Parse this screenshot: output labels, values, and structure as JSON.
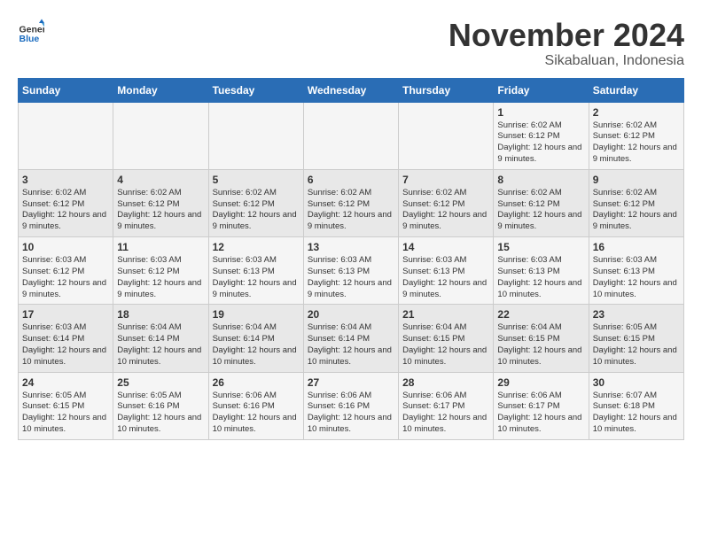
{
  "logo": {
    "text_general": "General",
    "text_blue": "Blue"
  },
  "title": "November 2024",
  "subtitle": "Sikabaluan, Indonesia",
  "days_of_week": [
    "Sunday",
    "Monday",
    "Tuesday",
    "Wednesday",
    "Thursday",
    "Friday",
    "Saturday"
  ],
  "weeks": [
    {
      "days": [
        {
          "number": "",
          "info": ""
        },
        {
          "number": "",
          "info": ""
        },
        {
          "number": "",
          "info": ""
        },
        {
          "number": "",
          "info": ""
        },
        {
          "number": "",
          "info": ""
        },
        {
          "number": "1",
          "info": "Sunrise: 6:02 AM\nSunset: 6:12 PM\nDaylight: 12 hours and 9 minutes."
        },
        {
          "number": "2",
          "info": "Sunrise: 6:02 AM\nSunset: 6:12 PM\nDaylight: 12 hours and 9 minutes."
        }
      ]
    },
    {
      "days": [
        {
          "number": "3",
          "info": "Sunrise: 6:02 AM\nSunset: 6:12 PM\nDaylight: 12 hours and 9 minutes."
        },
        {
          "number": "4",
          "info": "Sunrise: 6:02 AM\nSunset: 6:12 PM\nDaylight: 12 hours and 9 minutes."
        },
        {
          "number": "5",
          "info": "Sunrise: 6:02 AM\nSunset: 6:12 PM\nDaylight: 12 hours and 9 minutes."
        },
        {
          "number": "6",
          "info": "Sunrise: 6:02 AM\nSunset: 6:12 PM\nDaylight: 12 hours and 9 minutes."
        },
        {
          "number": "7",
          "info": "Sunrise: 6:02 AM\nSunset: 6:12 PM\nDaylight: 12 hours and 9 minutes."
        },
        {
          "number": "8",
          "info": "Sunrise: 6:02 AM\nSunset: 6:12 PM\nDaylight: 12 hours and 9 minutes."
        },
        {
          "number": "9",
          "info": "Sunrise: 6:02 AM\nSunset: 6:12 PM\nDaylight: 12 hours and 9 minutes."
        }
      ]
    },
    {
      "days": [
        {
          "number": "10",
          "info": "Sunrise: 6:03 AM\nSunset: 6:12 PM\nDaylight: 12 hours and 9 minutes."
        },
        {
          "number": "11",
          "info": "Sunrise: 6:03 AM\nSunset: 6:12 PM\nDaylight: 12 hours and 9 minutes."
        },
        {
          "number": "12",
          "info": "Sunrise: 6:03 AM\nSunset: 6:13 PM\nDaylight: 12 hours and 9 minutes."
        },
        {
          "number": "13",
          "info": "Sunrise: 6:03 AM\nSunset: 6:13 PM\nDaylight: 12 hours and 9 minutes."
        },
        {
          "number": "14",
          "info": "Sunrise: 6:03 AM\nSunset: 6:13 PM\nDaylight: 12 hours and 9 minutes."
        },
        {
          "number": "15",
          "info": "Sunrise: 6:03 AM\nSunset: 6:13 PM\nDaylight: 12 hours and 10 minutes."
        },
        {
          "number": "16",
          "info": "Sunrise: 6:03 AM\nSunset: 6:13 PM\nDaylight: 12 hours and 10 minutes."
        }
      ]
    },
    {
      "days": [
        {
          "number": "17",
          "info": "Sunrise: 6:03 AM\nSunset: 6:14 PM\nDaylight: 12 hours and 10 minutes."
        },
        {
          "number": "18",
          "info": "Sunrise: 6:04 AM\nSunset: 6:14 PM\nDaylight: 12 hours and 10 minutes."
        },
        {
          "number": "19",
          "info": "Sunrise: 6:04 AM\nSunset: 6:14 PM\nDaylight: 12 hours and 10 minutes."
        },
        {
          "number": "20",
          "info": "Sunrise: 6:04 AM\nSunset: 6:14 PM\nDaylight: 12 hours and 10 minutes."
        },
        {
          "number": "21",
          "info": "Sunrise: 6:04 AM\nSunset: 6:15 PM\nDaylight: 12 hours and 10 minutes."
        },
        {
          "number": "22",
          "info": "Sunrise: 6:04 AM\nSunset: 6:15 PM\nDaylight: 12 hours and 10 minutes."
        },
        {
          "number": "23",
          "info": "Sunrise: 6:05 AM\nSunset: 6:15 PM\nDaylight: 12 hours and 10 minutes."
        }
      ]
    },
    {
      "days": [
        {
          "number": "24",
          "info": "Sunrise: 6:05 AM\nSunset: 6:15 PM\nDaylight: 12 hours and 10 minutes."
        },
        {
          "number": "25",
          "info": "Sunrise: 6:05 AM\nSunset: 6:16 PM\nDaylight: 12 hours and 10 minutes."
        },
        {
          "number": "26",
          "info": "Sunrise: 6:06 AM\nSunset: 6:16 PM\nDaylight: 12 hours and 10 minutes."
        },
        {
          "number": "27",
          "info": "Sunrise: 6:06 AM\nSunset: 6:16 PM\nDaylight: 12 hours and 10 minutes."
        },
        {
          "number": "28",
          "info": "Sunrise: 6:06 AM\nSunset: 6:17 PM\nDaylight: 12 hours and 10 minutes."
        },
        {
          "number": "29",
          "info": "Sunrise: 6:06 AM\nSunset: 6:17 PM\nDaylight: 12 hours and 10 minutes."
        },
        {
          "number": "30",
          "info": "Sunrise: 6:07 AM\nSunset: 6:18 PM\nDaylight: 12 hours and 10 minutes."
        }
      ]
    }
  ]
}
